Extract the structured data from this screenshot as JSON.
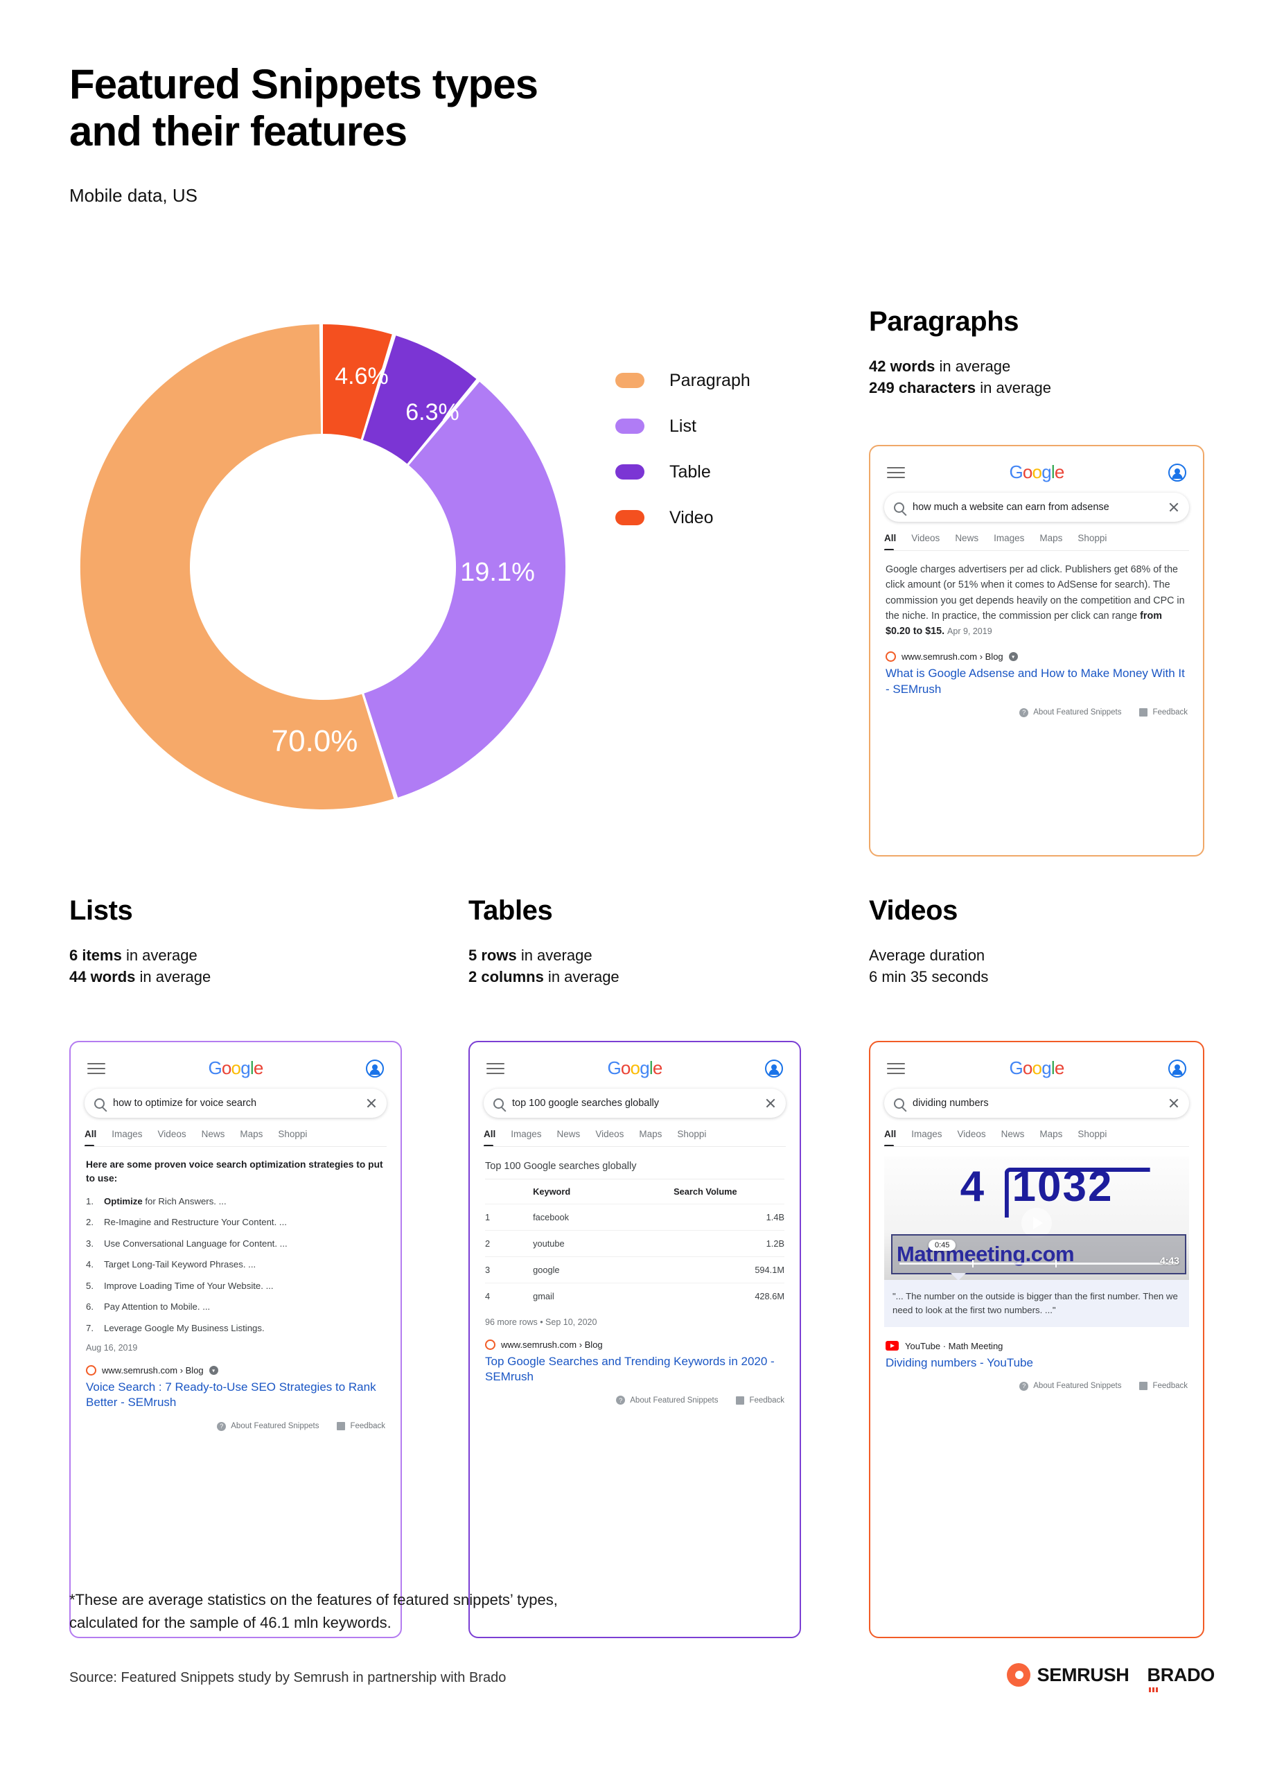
{
  "header": {
    "title_line1": "Featured Snippets types",
    "title_line2": "and their features",
    "subtitle": "Mobile data, US"
  },
  "chart_data": {
    "type": "pie",
    "variant": "donut",
    "title": "Featured Snippets types and their features",
    "subtitle": "Mobile data, US",
    "unit": "percent",
    "categories": [
      "Paragraph",
      "List",
      "Table",
      "Video"
    ],
    "values": [
      70.0,
      19.1,
      6.3,
      4.6
    ],
    "labels": [
      "70.0%",
      "19.1%",
      "6.3%",
      "4.6%"
    ],
    "colors": [
      "#f6a969",
      "#b07cf5",
      "#7b35d4",
      "#f4501f"
    ],
    "legend_position": "right",
    "start_angle_deg": 0,
    "direction": "clockwise",
    "slice_order_from_top": [
      "Video",
      "Table",
      "List",
      "Paragraph"
    ]
  },
  "legend": [
    {
      "label": "Paragraph",
      "color": "#f6a969"
    },
    {
      "label": "List",
      "color": "#b07cf5"
    },
    {
      "label": "Table",
      "color": "#7b35d4"
    },
    {
      "label": "Video",
      "color": "#f4501f"
    }
  ],
  "sections": {
    "paragraphs": {
      "heading": "Paragraphs",
      "stat1_value": "42 words",
      "stat1_rest": " in average",
      "stat2_value": "249 characters",
      "stat2_rest": " in average"
    },
    "lists": {
      "heading": "Lists",
      "stat1_value": "6 items",
      "stat1_rest": " in average",
      "stat2_value": "44 words",
      "stat2_rest": " in average"
    },
    "tables": {
      "heading": "Tables",
      "stat1_value": "5 rows",
      "stat1_rest": " in average",
      "stat2_value": "2 columns",
      "stat2_rest": " in average"
    },
    "videos": {
      "heading": "Videos",
      "stat1_value": "Average duration",
      "stat1_rest": "",
      "stat2_value": "6 min 35 seconds",
      "stat2_rest": ""
    }
  },
  "serp_common": {
    "logo": {
      "g1": "G",
      "o1": "o",
      "o2": "o",
      "g2": "g",
      "l": "l",
      "e": "e"
    },
    "about_featured_snippets": "About Featured Snippets",
    "feedback": "Feedback"
  },
  "serp_paragraph": {
    "query": "how much a website can earn from adsense",
    "tabs": [
      "All",
      "Videos",
      "News",
      "Images",
      "Maps",
      "Shoppi"
    ],
    "body_part1": "Google charges advertisers per ad click. Publishers get 68% of the click amount (or 51% when it comes to AdSense for search). The commission you get depends heavily on the competition and CPC in the niche. In practice, the commission per click can range ",
    "body_bold": "from $0.20",
    "body_part2": " to $15.",
    "date": "Apr 9, 2019",
    "source_url": "www.semrush.com › Blog",
    "result_title": "What is Google Adsense and How to Make Money With It - SEMrush"
  },
  "serp_list": {
    "query": "how to optimize for voice search",
    "tabs": [
      "All",
      "Images",
      "Videos",
      "News",
      "Maps",
      "Shoppi"
    ],
    "intro": "Here are some proven voice search optimization strategies to put to use:",
    "items": [
      {
        "num": "1.",
        "bold": "Optimize",
        "rest": " for Rich Answers. ..."
      },
      {
        "num": "2.",
        "bold": "",
        "rest": "Re-Imagine and Restructure Your Content. ..."
      },
      {
        "num": "3.",
        "bold": "",
        "rest": "Use Conversational Language for Content. ..."
      },
      {
        "num": "4.",
        "bold": "",
        "rest": "Target Long-Tail Keyword Phrases. ..."
      },
      {
        "num": "5.",
        "bold": "",
        "rest": "Improve Loading Time of Your Website. ..."
      },
      {
        "num": "6.",
        "bold": "",
        "rest": "Pay Attention to Mobile. ..."
      },
      {
        "num": "7.",
        "bold": "",
        "rest": "Leverage Google My Business Listings."
      }
    ],
    "date": "Aug 16, 2019",
    "source_url": "www.semrush.com › Blog",
    "result_title": "Voice Search : 7 Ready-to-Use SEO Strategies to Rank Better - SEMrush"
  },
  "serp_table": {
    "query": "top 100 google searches globally",
    "tabs": [
      "All",
      "Images",
      "News",
      "Videos",
      "Maps",
      "Shoppi"
    ],
    "table_title": "Top 100 Google searches globally",
    "columns": [
      "",
      "Keyword",
      "Search Volume"
    ],
    "rows": [
      [
        "1",
        "facebook",
        "1.4B"
      ],
      [
        "2",
        "youtube",
        "1.2B"
      ],
      [
        "3",
        "google",
        "594.1M"
      ],
      [
        "4",
        "gmail",
        "428.6M"
      ]
    ],
    "more_rows": "96 more rows",
    "more_rows_date": " • Sep 10, 2020",
    "source_url": "www.semrush.com › Blog",
    "result_title": "Top Google Searches and Trending Keywords in 2020 - SEMrush"
  },
  "serp_video": {
    "query": "dividing numbers",
    "tabs": [
      "All",
      "Images",
      "Videos",
      "News",
      "Maps",
      "Shoppi"
    ],
    "thumb_divisor": "4",
    "thumb_dividend": "1032",
    "thumb_brand": "Mathmeeting.com",
    "thumb_current_time": "0:45",
    "thumb_duration": "4:43",
    "quote": "\"... The number on the outside is bigger than the first number. Then we need to look at the first two numbers. ...\"",
    "channel": "YouTube · Math Meeting",
    "result_title": "Dividing numbers - YouTube"
  },
  "footer": {
    "footnote_line1": "*These are average statistics on the features of featured snippets’ types,",
    "footnote_line2": "calculated for the sample of 46.1 mln keywords.",
    "source": "Source: Featured Snippets study by Semrush in partnership with Brado",
    "logo_semrush": "SEMRUSH",
    "logo_brado": "BRADO"
  }
}
